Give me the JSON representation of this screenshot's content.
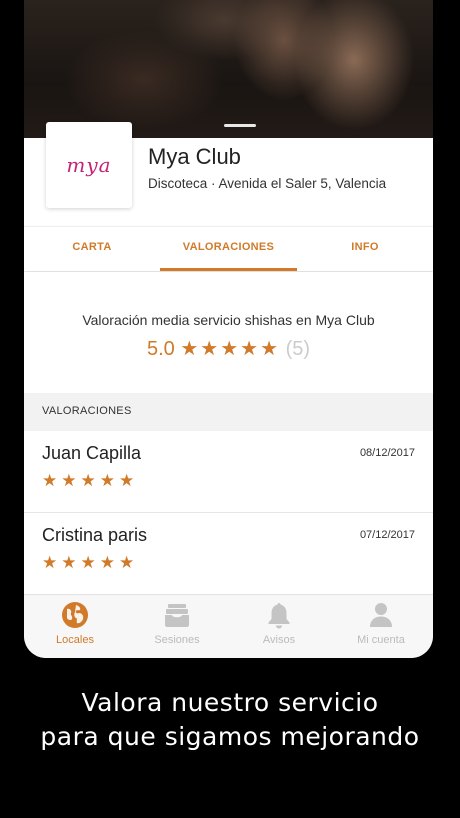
{
  "venue": {
    "logo_text": "mya",
    "name": "Mya Club",
    "subtitle": "Discoteca · Avenida el Saler 5, Valencia"
  },
  "tabs": [
    {
      "label": "CARTA",
      "active": false
    },
    {
      "label": "VALORACIONES",
      "active": true
    },
    {
      "label": "INFO",
      "active": false
    }
  ],
  "rating_summary": {
    "title": "Valoración media servicio shishas en Mya Club",
    "score": "5.0",
    "stars": 5,
    "stars_text": "★★★★★",
    "count": "(5)"
  },
  "reviews_section": {
    "header": "VALORACIONES",
    "items": [
      {
        "name": "Juan Capilla",
        "date": "08/12/2017",
        "stars": 5,
        "stars_text": "★★★★★"
      },
      {
        "name": "Cristina paris",
        "date": "07/12/2017",
        "stars": 5,
        "stars_text": "★★★★★"
      }
    ]
  },
  "bottom_nav": [
    {
      "label": "Locales",
      "icon": "globe-icon",
      "active": true
    },
    {
      "label": "Sesiones",
      "icon": "inbox-icon",
      "active": false
    },
    {
      "label": "Avisos",
      "icon": "bell-icon",
      "active": false
    },
    {
      "label": "Mi cuenta",
      "icon": "user-icon",
      "active": false
    }
  ],
  "tagline": {
    "line1": "Valora nuestro servicio",
    "line2": "para que sigamos mejorando"
  },
  "colors": {
    "accent": "#d07a2a",
    "logo": "#c2247a",
    "inactive": "#bbbbbb"
  }
}
